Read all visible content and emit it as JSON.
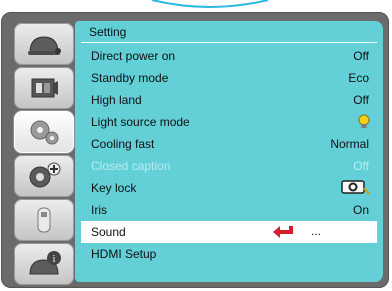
{
  "menu": {
    "title": "Setting",
    "items": [
      {
        "label": "Direct power on",
        "value": "Off"
      },
      {
        "label": "Standby mode",
        "value": "Eco"
      },
      {
        "label": "High land",
        "value": "Off"
      },
      {
        "label": "Light source mode",
        "value": "",
        "icon": "lightbulb-icon"
      },
      {
        "label": "Cooling fast",
        "value": "Normal"
      },
      {
        "label": "Closed caption",
        "value": "Off",
        "disabled": true
      },
      {
        "label": "Key lock",
        "value": "",
        "icon": "key-lock-icon"
      },
      {
        "label": "Iris",
        "value": "On"
      },
      {
        "label": "Sound",
        "value": "...",
        "selected": true,
        "icon": "return-arrow-icon"
      },
      {
        "label": "HDMI Setup",
        "value": ""
      }
    ]
  },
  "sidebar": {
    "tabs": [
      {
        "icon": "image-adjust-icon"
      },
      {
        "icon": "display-icon"
      },
      {
        "icon": "setting-gear-icon",
        "active": true
      },
      {
        "icon": "extended-gear-icon"
      },
      {
        "icon": "usb-icon"
      },
      {
        "icon": "info-icon"
      }
    ]
  },
  "colors": {
    "panel": "#63cfd6",
    "selected_row": "#ffffff",
    "frame": "#6b6b6b",
    "accent_arrow": "#d61f26",
    "bulb": "#f2d21a"
  }
}
